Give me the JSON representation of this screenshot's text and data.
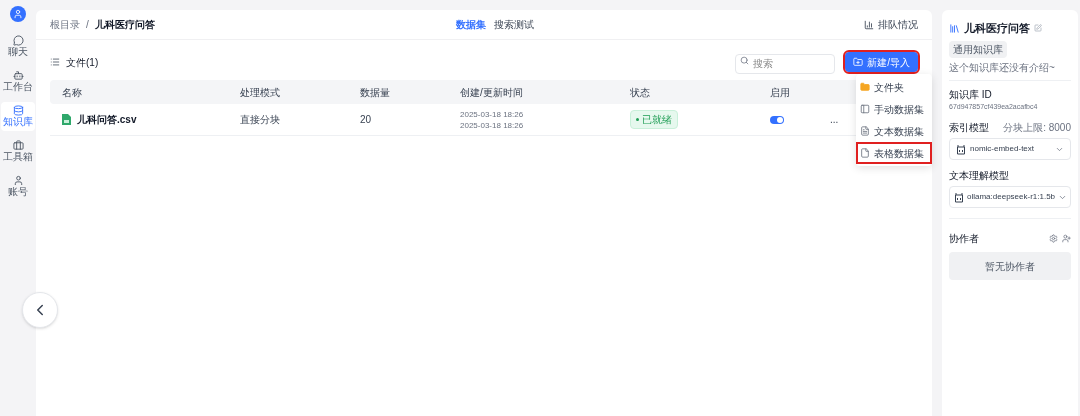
{
  "nav": [
    {
      "label": "聊天",
      "selected": false
    },
    {
      "label": "工作台",
      "selected": false
    },
    {
      "label": "知识库",
      "selected": true
    },
    {
      "label": "工具箱",
      "selected": false
    },
    {
      "label": "账号",
      "selected": false
    }
  ],
  "breadcrumb": [
    "根目录",
    "/",
    "儿科医疗问答"
  ],
  "tabs": [
    {
      "label": "数据集",
      "selected": true
    },
    {
      "label": "搜索测试",
      "selected": false
    }
  ],
  "queue_link": "排队情况",
  "files_title": "文件(1)",
  "search": {
    "placeholder": "搜索"
  },
  "new_button": {
    "label": "新建/导入",
    "highlighted": true
  },
  "menu": [
    {
      "label": "文件夹",
      "kind": "folder",
      "highlighted": false
    },
    {
      "label": "手动数据集",
      "kind": "manual",
      "highlighted": false
    },
    {
      "label": "文本数据集",
      "kind": "text",
      "highlighted": false
    },
    {
      "label": "表格数据集",
      "kind": "table",
      "highlighted": true
    }
  ],
  "table": {
    "columns": [
      "名称",
      "处理模式",
      "数据量",
      "创建/更新时间",
      "状态",
      "启用"
    ],
    "rows": [
      {
        "name": "儿科问答.csv",
        "mode": "直接分块",
        "count": "20",
        "created": "2025-03-18 18:26",
        "updated": "2025-03-18 18:26",
        "status": "已就绪",
        "enabled": true,
        "more": "..."
      }
    ]
  },
  "info": {
    "title": "儿科医疗问答",
    "tag": "通用知识库",
    "intro": "这个知识库还没有介绍~",
    "id_label": "知识库 ID",
    "id": "67d947857cf439ea2acafbc4",
    "index_label": "索引模型",
    "chunk_limit": "分块上限: 8000",
    "index_model": "nomic-embed-text",
    "llm_label": "文本理解模型",
    "llm_model": "ollama:deepseek-r1:1.5b",
    "collab_label": "协作者",
    "collab_empty": "暂无协作者"
  }
}
